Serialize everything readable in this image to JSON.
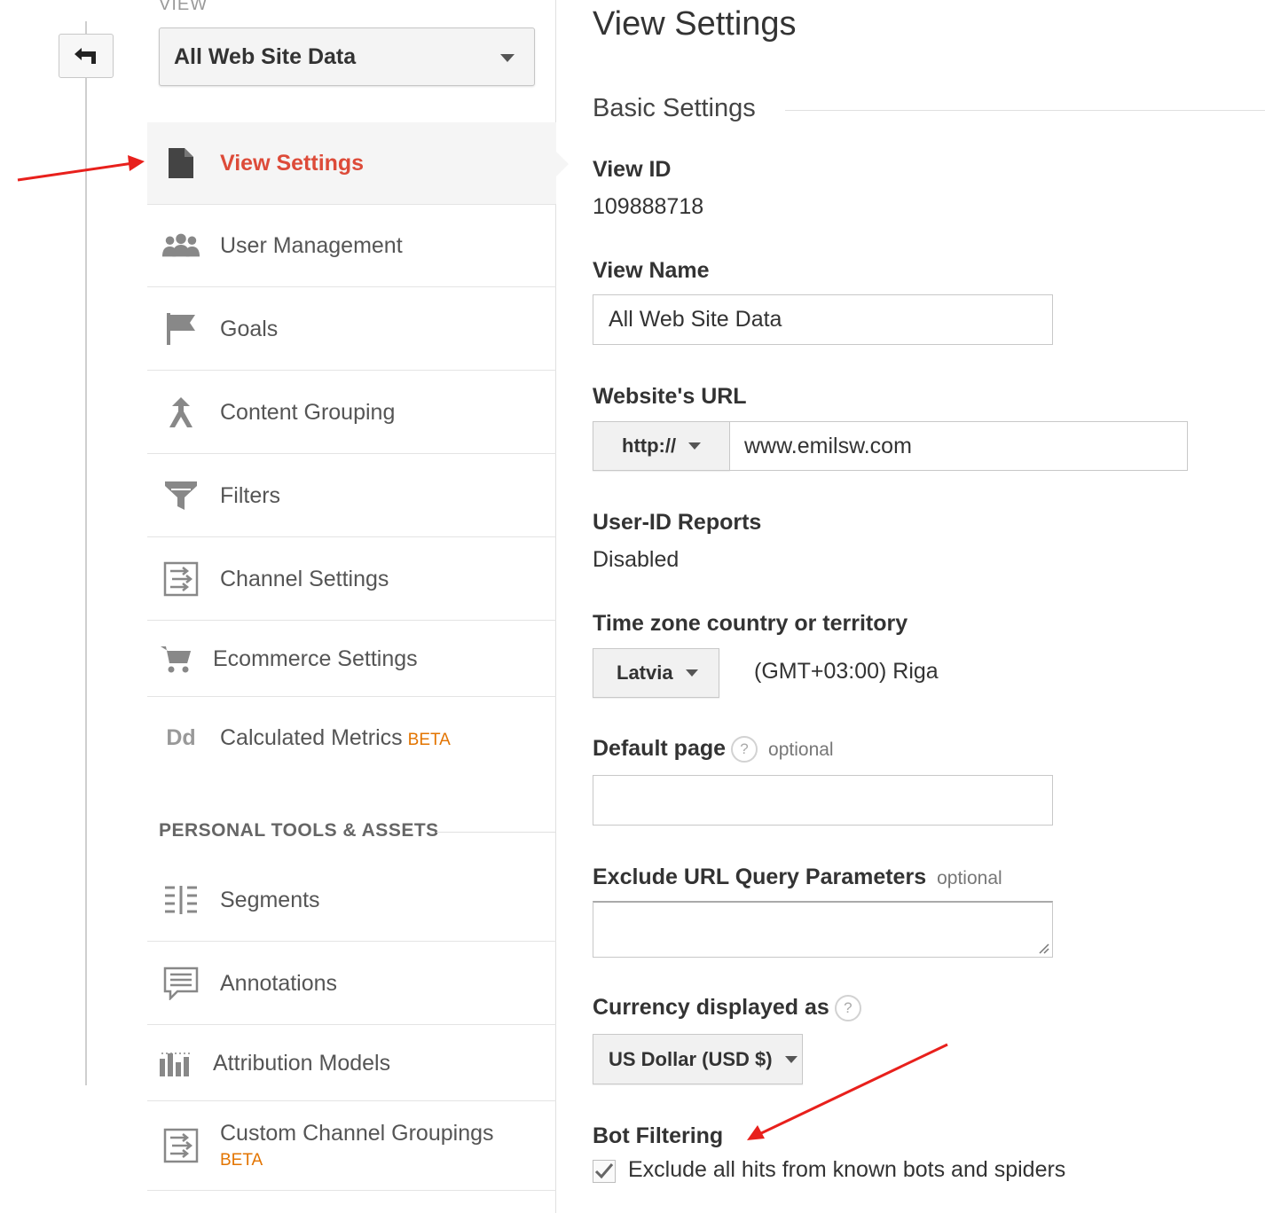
{
  "sidebar": {
    "view_caption": "VIEW",
    "view_select_value": "All Web Site Data",
    "items": [
      {
        "label": "View Settings",
        "icon": "document-icon"
      },
      {
        "label": "User Management",
        "icon": "users-icon"
      },
      {
        "label": "Goals",
        "icon": "flag-icon"
      },
      {
        "label": "Content Grouping",
        "icon": "content-grouping-icon"
      },
      {
        "label": "Filters",
        "icon": "filter-icon"
      },
      {
        "label": "Channel Settings",
        "icon": "channel-settings-icon"
      },
      {
        "label": "Ecommerce Settings",
        "icon": "cart-icon"
      },
      {
        "label": "Calculated Metrics",
        "icon": "calculated-metrics-icon",
        "badge": "BETA",
        "icon_text": "Dd"
      }
    ],
    "personal_section_title": "PERSONAL TOOLS & ASSETS",
    "personal_items": [
      {
        "label": "Segments",
        "icon": "segments-icon"
      },
      {
        "label": "Annotations",
        "icon": "annotations-icon"
      },
      {
        "label": "Attribution Models",
        "icon": "attribution-icon"
      },
      {
        "label": "Custom Channel Groupings",
        "icon": "custom-channel-icon",
        "badge": "BETA"
      }
    ]
  },
  "main": {
    "title": "View Settings",
    "section_title": "Basic Settings",
    "view_id_label": "View ID",
    "view_id_value": "109888718",
    "view_name_label": "View Name",
    "view_name_value": "All Web Site Data",
    "website_url_label": "Website's URL",
    "protocol_value": "http://",
    "url_value": "www.emilsw.com",
    "user_id_label": "User-ID Reports",
    "user_id_value": "Disabled",
    "timezone_label": "Time zone country or territory",
    "timezone_country": "Latvia",
    "timezone_value": "(GMT+03:00) Riga",
    "default_page_label": "Default page",
    "help_glyph": "?",
    "optional_text": "optional",
    "default_page_value": "",
    "exclude_label": "Exclude URL Query Parameters",
    "exclude_value": "",
    "currency_label": "Currency displayed as",
    "currency_value": "US Dollar (USD $)",
    "bot_filter_label": "Bot Filtering",
    "bot_filter_checkbox_label": "Exclude all hits from known bots and spiders",
    "bot_filter_checked": true
  },
  "colors": {
    "accent_red": "#dd4b39",
    "beta_orange": "#e37400",
    "annotation_arrow": "#e8201c"
  }
}
